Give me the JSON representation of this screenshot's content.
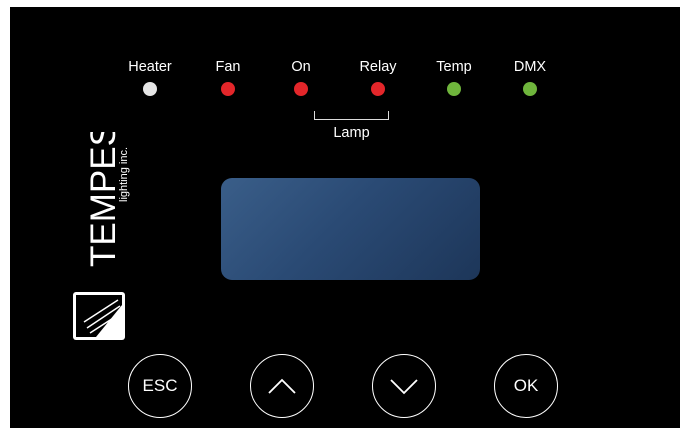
{
  "indicators": [
    {
      "label": "Heater",
      "color": "#e6e6e6"
    },
    {
      "label": "Fan",
      "color": "#e3262a"
    },
    {
      "label": "On",
      "color": "#e3262a"
    },
    {
      "label": "Relay",
      "color": "#e3262a"
    },
    {
      "label": "Temp",
      "color": "#6fb53c"
    },
    {
      "label": "DMX",
      "color": "#6fb53c"
    }
  ],
  "lamp_group_label": "Lamp",
  "brand": {
    "name": "TEMPEST",
    "tagline": "lighting inc."
  },
  "buttons": {
    "esc": "ESC",
    "up_icon": "chevron-up-icon",
    "down_icon": "chevron-down-icon",
    "ok": "OK"
  },
  "display": {
    "color": "#2b4c76"
  }
}
